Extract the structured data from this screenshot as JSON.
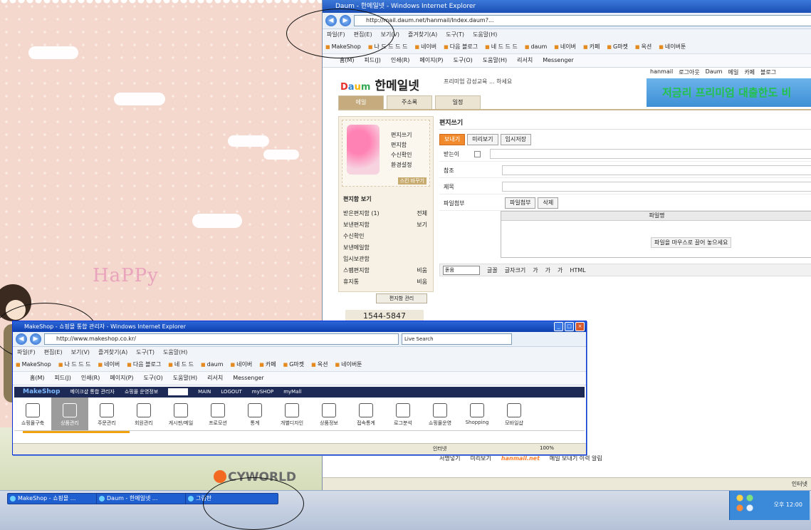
{
  "ie_back": {
    "title": "Daum - 한메일넷 - Windows Internet Explorer",
    "address": "http://mail.daum.net/hanmail/Index.daum?...",
    "menu": [
      "파일(F)",
      "편집(E)",
      "보기(V)",
      "즐겨찾기(A)",
      "도구(T)",
      "도움말(H)"
    ],
    "favorites": [
      "MakeShop",
      "나 드 드 드 드",
      "네이버",
      "다음 블로그",
      "네 드 드 드",
      "daum",
      "네이버",
      "카페",
      "G마켓",
      "옥션",
      "네이버툰"
    ],
    "commands": [
      "홈(M)",
      "피드(J)",
      "인쇄(R)",
      "페이지(P)",
      "도구(O)",
      "도움말(H)",
      "리서치",
      "Messenger"
    ],
    "logo": "한메일넷",
    "promo": "프리미엄 감성교육 ... 하세요",
    "top_links": [
      "hanmail",
      "로그아웃",
      "Daum",
      "메일",
      "카페",
      "블로그"
    ],
    "banner": "저금리 프리미엄 대출한도 비",
    "tabs": [
      "메일",
      "주소록",
      "일정"
    ],
    "stamp_menu": [
      "편지쓰기",
      "편지함",
      "수신확인",
      "환경설정"
    ],
    "stamp_tag": "스킨 바꾸기",
    "mailbox_title": "편지함 보기",
    "mailbox": [
      {
        "label": "받은편지함 (1)",
        "count": "전체"
      },
      {
        "label": "보낸편지함",
        "count": "보기"
      },
      {
        "label": "수신확인",
        "count": ""
      },
      {
        "label": "보낸메일함",
        "count": ""
      },
      {
        "label": "임시보관함",
        "count": ""
      },
      {
        "label": "스팸편지함",
        "count": "비움"
      },
      {
        "label": "휴지통",
        "count": "비움"
      }
    ],
    "folder_btn": "편지함 관리",
    "phone": "1544-5847",
    "compose_title": "편지쓰기",
    "buttons": [
      "보내기",
      "미리보기",
      "임시저장"
    ],
    "fields": {
      "to": "받는이",
      "cc": "참조",
      "subject": "제목",
      "attach": "파일첨부"
    },
    "attach_btns": [
      "파일첨부",
      "삭제"
    ],
    "attach_header": "파일명",
    "attach_hint": "파일을 마우스로 끌어 놓으세요",
    "editor_font": "돋움",
    "editor_items": [
      "글꼴",
      "글자크기",
      "가",
      "가",
      "가",
      "HTML"
    ],
    "bottom_items": [
      "서명넣기",
      "미리보기",
      "hanmail.net",
      "메일 보내기 이력 알림"
    ],
    "hanmail": "hanmail.net",
    "status_zone": "인터넷"
  },
  "ie_front": {
    "title": "MakeShop - 쇼핑몰 통합 관리자 - Windows Internet Explorer",
    "address": "http://www.makeshop.co.kr/",
    "search_placeholder": "Live Search",
    "menu": [
      "파일(F)",
      "편집(E)",
      "보기(V)",
      "즐겨찾기(A)",
      "도구(T)",
      "도움말(H)"
    ],
    "favorites": [
      "MakeShop",
      "나 드 드 드",
      "네이버",
      "다음 블로그",
      "네 드 드",
      "daum",
      "네이버",
      "카페",
      "G마켓",
      "옥션",
      "네이버툰"
    ],
    "commands": [
      "홈(M)",
      "피드(J)",
      "인쇄(R)",
      "페이지(P)",
      "도구(O)",
      "도움말(H)",
      "리서치",
      "Messenger"
    ],
    "brand": "MakeShop",
    "nav": [
      "메이크샵 통합 관리자",
      "쇼핑몰 운영정보",
      "MAIN",
      "LOGOUT",
      "mySHOP",
      "myMall"
    ],
    "tools": [
      "쇼핑몰구축",
      "상품관리",
      "주문관리",
      "회원관리",
      "게시판/메일",
      "프로모션",
      "통계",
      "개별디자인",
      "상품정보",
      "접속통계",
      "로그분석",
      "쇼핑몰운영",
      "Shopping",
      "모바일샵"
    ],
    "status_zone": "인터넷",
    "status_zoom": "100%"
  },
  "desktop": {
    "happy": "HaPPy",
    "cyworld": "CYWORLD"
  },
  "taskbar": {
    "tasks": [
      "MakeShop - 쇼핑몰 ...",
      "Daum - 한메일넷 ...",
      "그림판"
    ],
    "time": "오후 12:00"
  }
}
